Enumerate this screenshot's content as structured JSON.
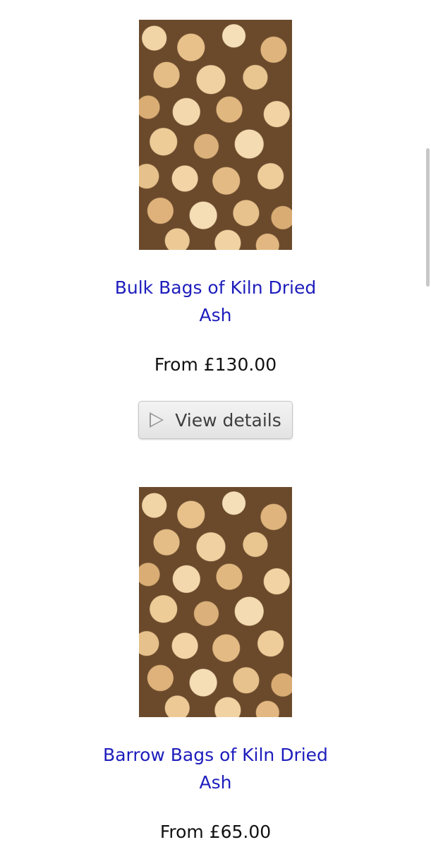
{
  "products": [
    {
      "title": "Bulk Bags of Kiln Dried Ash",
      "price": "From £130.00",
      "button_label": "View details"
    },
    {
      "title": "Barrow Bags of Kiln Dried Ash",
      "price": "From £65.00"
    }
  ],
  "icons": {
    "details": "play-triangle-icon"
  },
  "colors": {
    "link": "#1d1dbd",
    "text": "#111111",
    "button_bg": "#ececec",
    "button_text": "#3f3f3f"
  }
}
